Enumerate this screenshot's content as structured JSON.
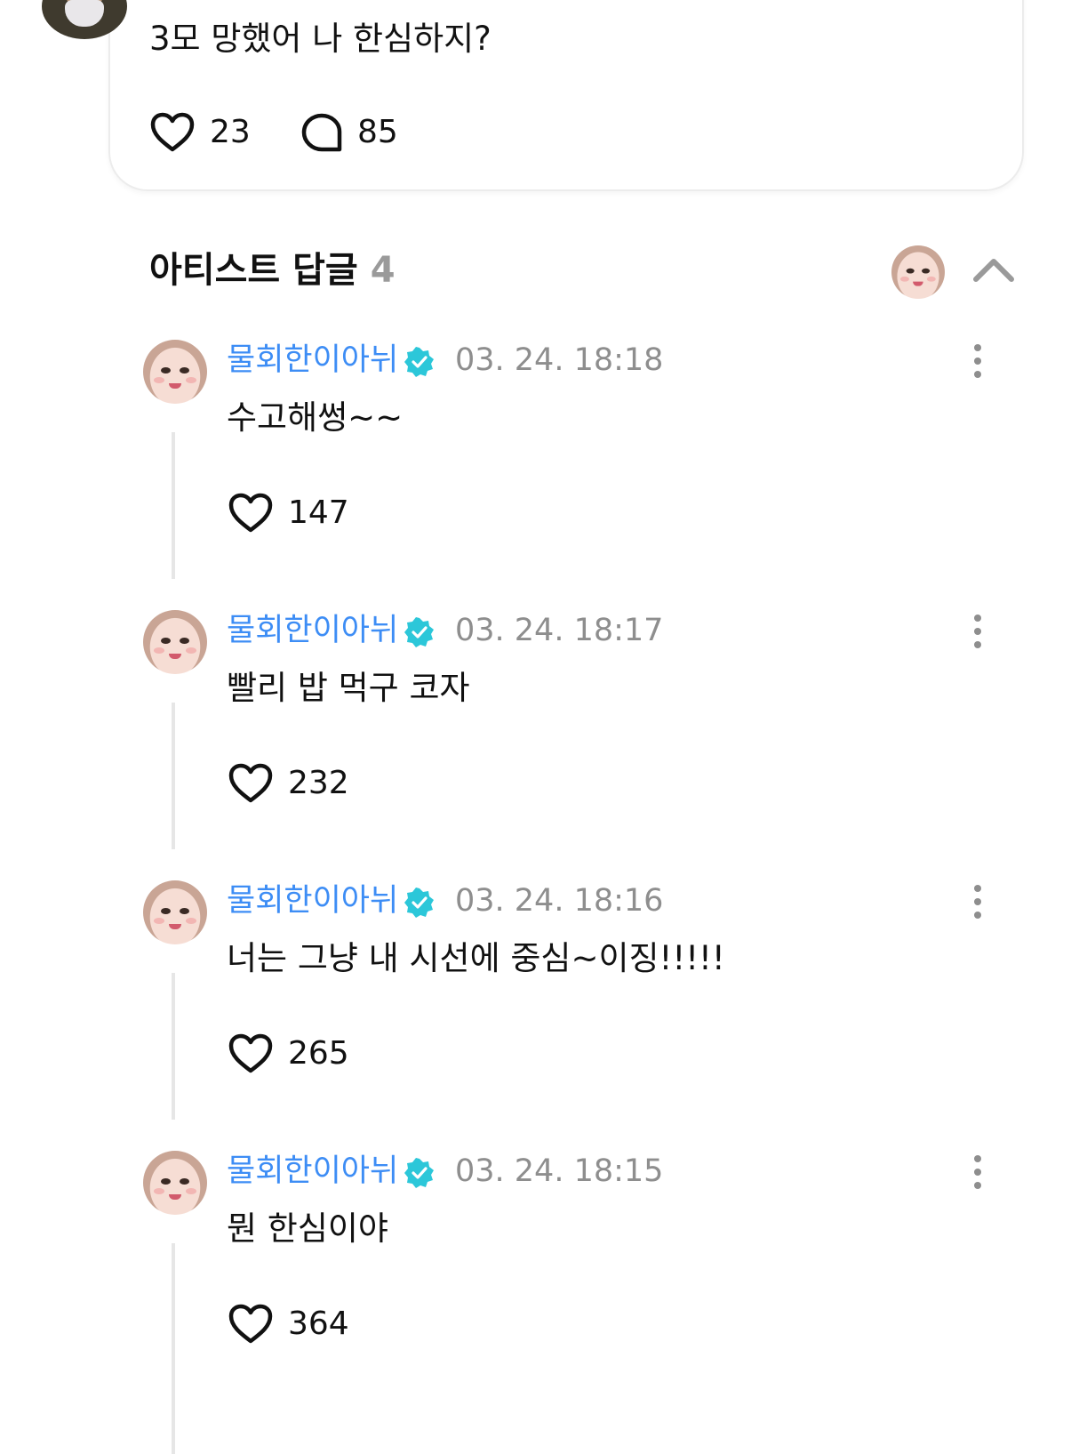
{
  "post": {
    "text": "3모 망했어 나 한심하지?",
    "like_count": "23",
    "comment_count": "85"
  },
  "section": {
    "title": "아티스트 답글",
    "count": "4"
  },
  "replies": [
    {
      "author": "물회한이아뉘",
      "time": "03. 24. 18:18",
      "text": "수고해썽~~",
      "likes": "147"
    },
    {
      "author": "물회한이아뉘",
      "time": "03. 24. 18:17",
      "text": "빨리 밥 먹구 코자",
      "likes": "232"
    },
    {
      "author": "물회한이아뉘",
      "time": "03. 24. 18:16",
      "text": "너는 그냥 내 시선에 중심~이징!!!!!",
      "likes": "265"
    },
    {
      "author": "물회한이아뉘",
      "time": "03. 24. 18:15",
      "text": "뭔 한심이야",
      "likes": "364"
    }
  ],
  "icons": {
    "like": "heart-outline-icon",
    "comment": "speech-bubble-icon",
    "verified": "verified-badge-icon",
    "more": "more-vertical-icon",
    "collapse": "chevron-up-icon"
  },
  "colors": {
    "author_name": "#3d8df5",
    "verified_badge": "#2cc7d9",
    "timestamp": "#8e8e8e",
    "count_muted": "#9a9a9a"
  }
}
